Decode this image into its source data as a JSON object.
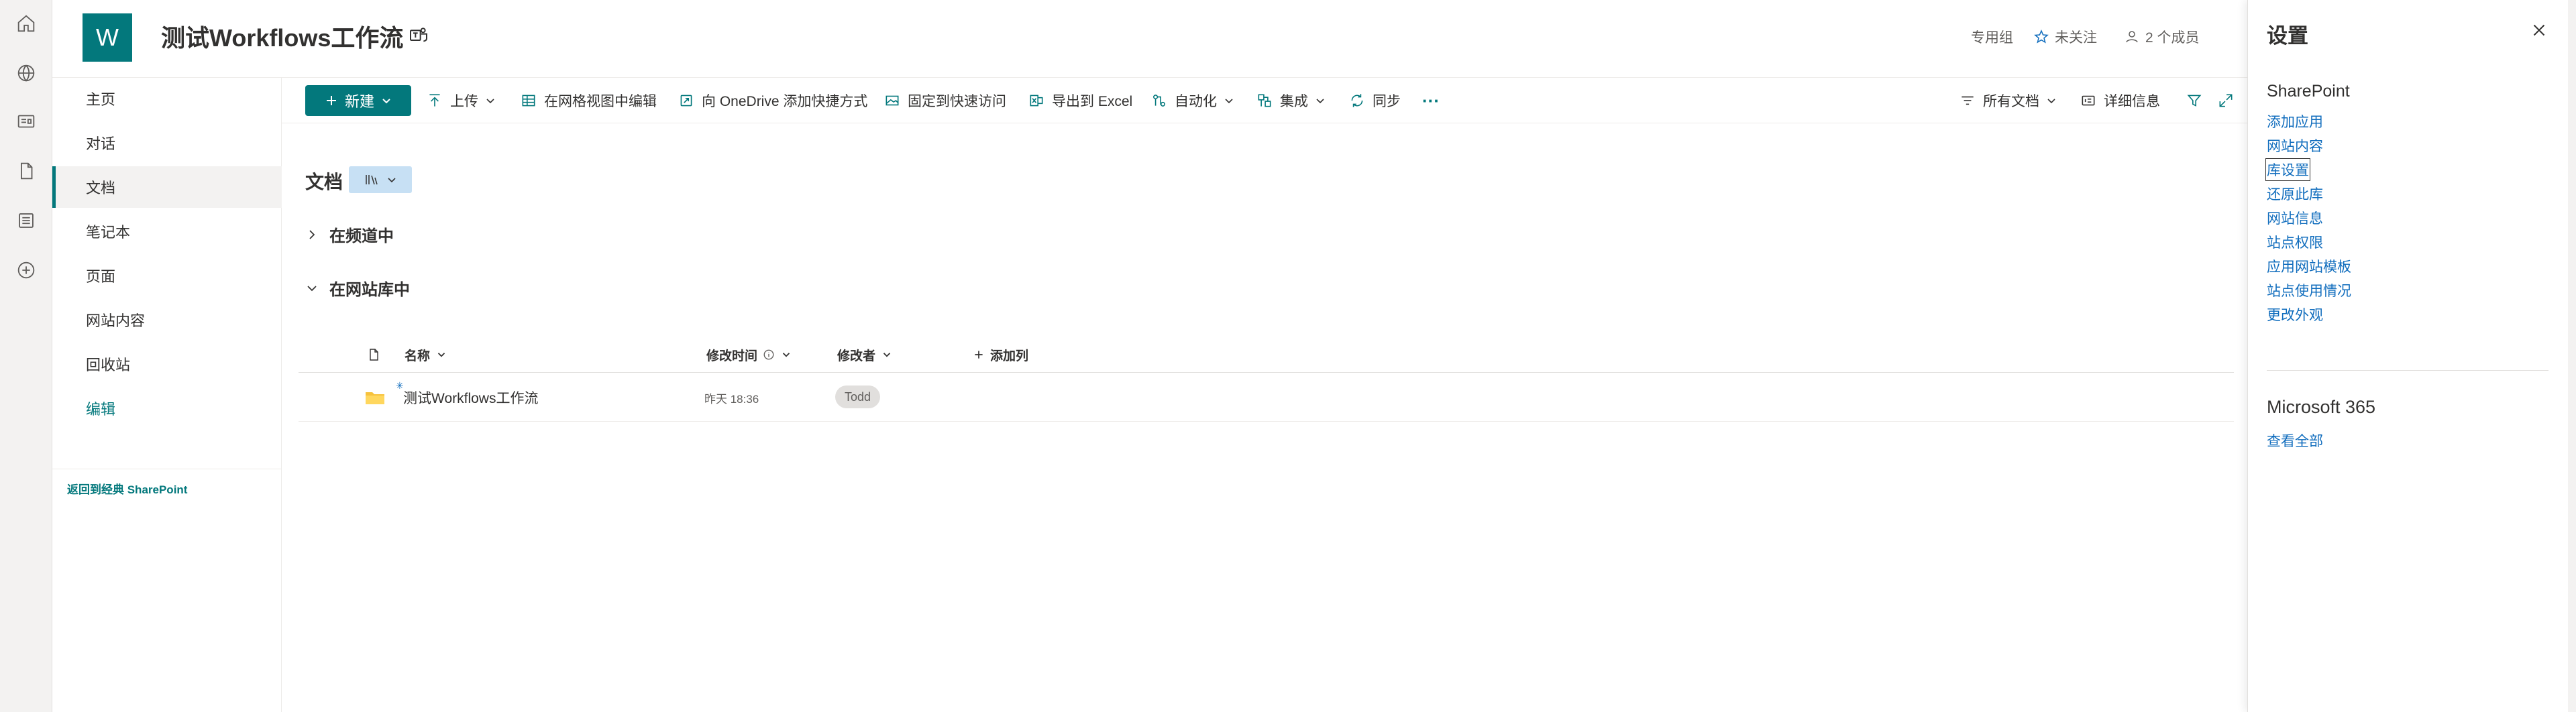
{
  "site": {
    "logo_letter": "W",
    "title": "测试Workflows工作流",
    "group_type": "专用组",
    "follow_label": "未关注",
    "members_label": "2 个成员"
  },
  "leftnav": {
    "items": [
      "主页",
      "对话",
      "文档",
      "笔记本",
      "页面",
      "网站内容",
      "回收站"
    ],
    "selected": "文档",
    "edit_label": "编辑",
    "back_link": "返回到经典 SharePoint"
  },
  "commandbar": {
    "new_label": "新建",
    "upload_label": "上传",
    "grid_edit_label": "在网格视图中编辑",
    "onedrive_shortcut_label": "向 OneDrive 添加快捷方式",
    "pin_label": "固定到快速访问",
    "export_excel_label": "导出到 Excel",
    "automate_label": "自动化",
    "integrate_label": "集成",
    "sync_label": "同步",
    "more_label": "···",
    "view_label": "所有文档",
    "details_label": "详细信息"
  },
  "library": {
    "title": "文档",
    "groups": [
      {
        "label": "在频道中",
        "expanded": false
      },
      {
        "label": "在网站库中",
        "expanded": true
      }
    ],
    "columns": {
      "name": "名称",
      "modified": "修改时间",
      "modified_by": "修改者",
      "add_column": "添加列"
    },
    "rows": [
      {
        "name": "测试Workflows工作流",
        "modified": "昨天 18:36",
        "modified_by": "Todd"
      }
    ]
  },
  "settings_panel": {
    "title": "设置",
    "sharepoint_heading": "SharePoint",
    "links": [
      "添加应用",
      "网站内容",
      "库设置",
      "还原此库",
      "网站信息",
      "站点权限",
      "应用网站模板",
      "站点使用情况",
      "更改外观"
    ],
    "focused_link": "库设置",
    "m365_heading": "Microsoft 365",
    "m365_link": "查看全部"
  },
  "colors": {
    "accent": "#03787c",
    "link": "#0f6cbd",
    "folder": "#f7c23d"
  }
}
